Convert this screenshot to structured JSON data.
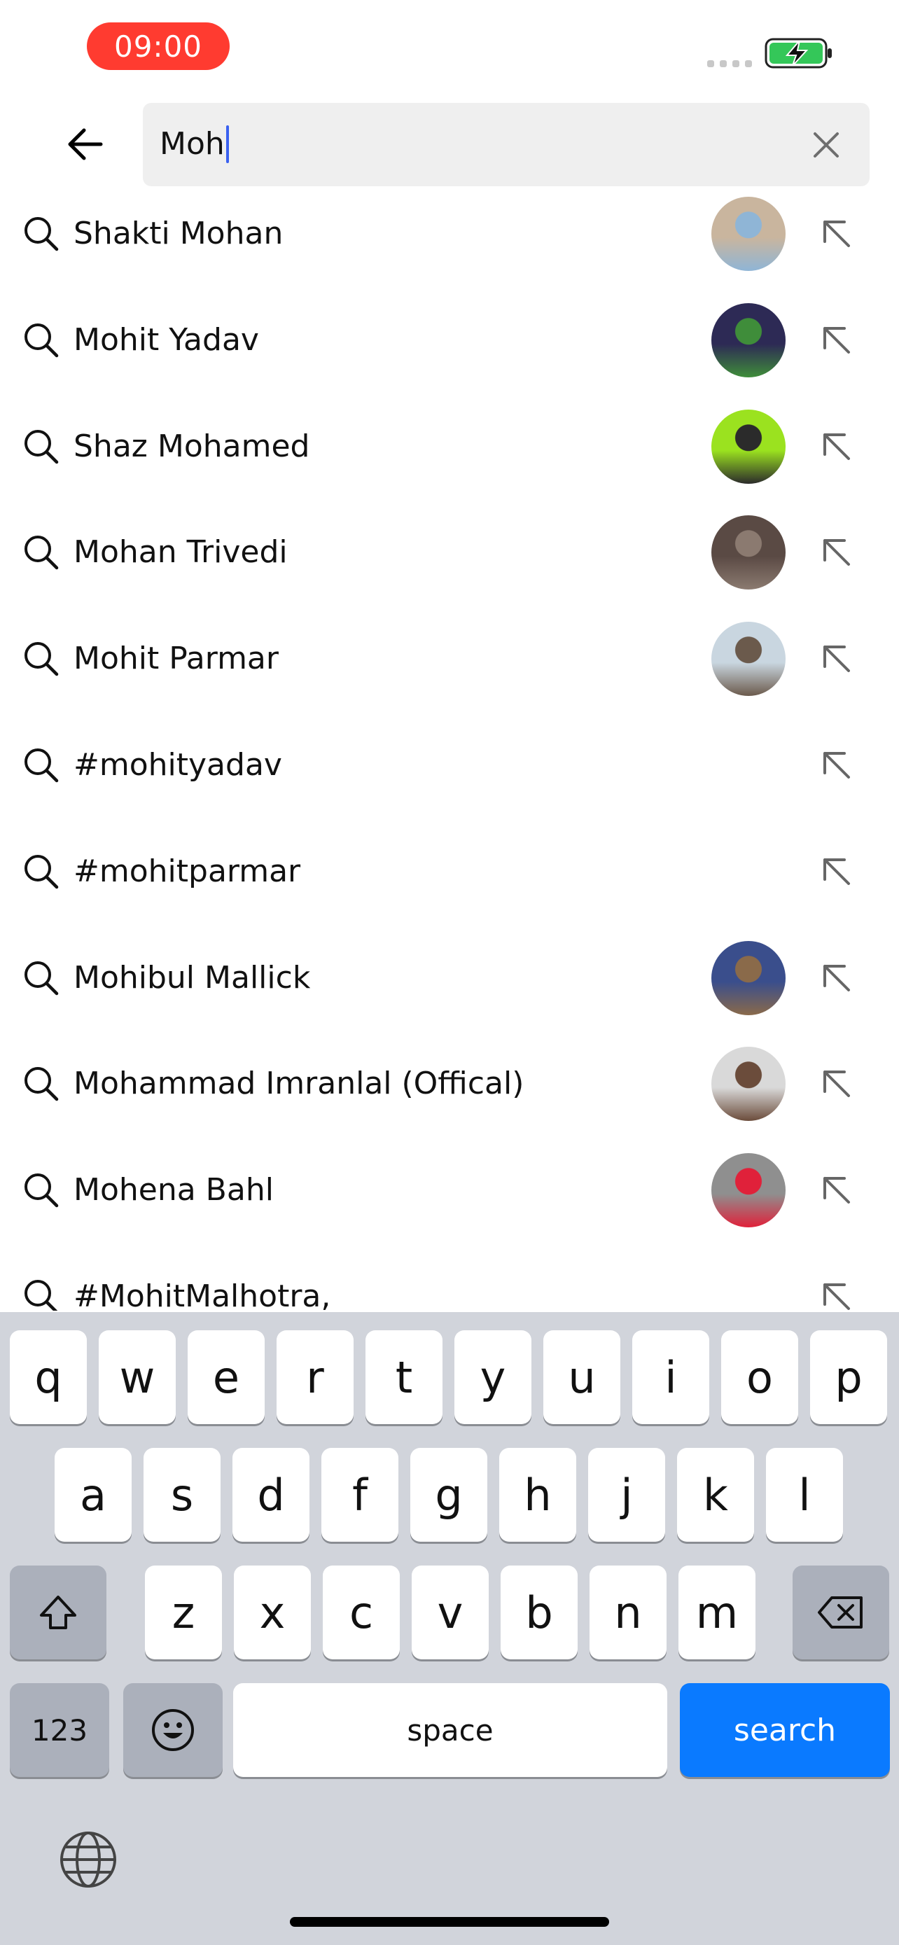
{
  "status_bar": {
    "time": "09:00"
  },
  "search": {
    "query": "Moh"
  },
  "results": [
    {
      "label": "Shakti Mohan",
      "avatar": true,
      "avatar_colors": [
        "#c9b59e",
        "#8fb5d6"
      ]
    },
    {
      "label": "Mohit Yadav",
      "avatar": true,
      "avatar_colors": [
        "#2d2a55",
        "#3f8d3a"
      ]
    },
    {
      "label": "Shaz Mohamed",
      "avatar": true,
      "avatar_colors": [
        "#9be21f",
        "#2b2b2b"
      ]
    },
    {
      "label": "Mohan Trivedi",
      "avatar": true,
      "avatar_colors": [
        "#5a4a44",
        "#8b7a70"
      ]
    },
    {
      "label": "Mohit Parmar",
      "avatar": true,
      "avatar_colors": [
        "#c9d6e0",
        "#6b5a4c"
      ]
    },
    {
      "label": "#mohityadav",
      "avatar": false
    },
    {
      "label": "#mohitparmar",
      "avatar": false
    },
    {
      "label": "Mohibul Mallick",
      "avatar": true,
      "avatar_colors": [
        "#3a4e8c",
        "#8a6a4a"
      ]
    },
    {
      "label": "Mohammad Imranlal (Offical)",
      "avatar": true,
      "avatar_colors": [
        "#d9d9d9",
        "#6b4c3b"
      ]
    },
    {
      "label": "Mohena Bahl",
      "avatar": true,
      "avatar_colors": [
        "#8f8f8f",
        "#e0213a"
      ]
    },
    {
      "label": "#MohitMalhotra,",
      "avatar": false
    }
  ],
  "keyboard": {
    "row1": [
      "q",
      "w",
      "e",
      "r",
      "t",
      "y",
      "u",
      "i",
      "o",
      "p"
    ],
    "row2": [
      "a",
      "s",
      "d",
      "f",
      "g",
      "h",
      "j",
      "k",
      "l"
    ],
    "row3": [
      "z",
      "x",
      "c",
      "v",
      "b",
      "n",
      "m"
    ],
    "numbers_label": "123",
    "space_label": "space",
    "search_label": "search"
  },
  "colors": {
    "accent": "#0a7aff",
    "time_pill": "#ff3b30",
    "caret": "#3a61f0",
    "battery": "#34c759"
  }
}
